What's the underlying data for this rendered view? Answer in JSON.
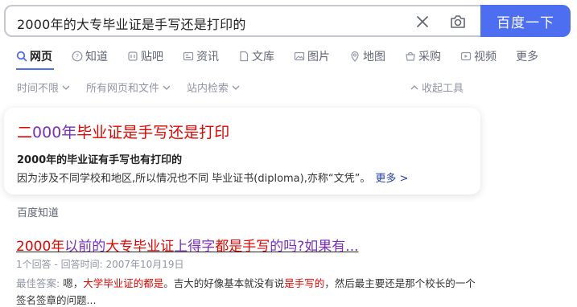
{
  "search": {
    "query": "2000年的大专毕业证是手写还是打印的",
    "button_label": "百度一下"
  },
  "tabs": [
    {
      "label": "网页",
      "icon": "search-icon",
      "active": true
    },
    {
      "label": "知道",
      "icon": "question-icon"
    },
    {
      "label": "贴吧",
      "icon": "tieba-icon"
    },
    {
      "label": "资讯",
      "icon": "news-icon"
    },
    {
      "label": "文库",
      "icon": "document-icon"
    },
    {
      "label": "图片",
      "icon": "image-icon"
    },
    {
      "label": "地图",
      "icon": "map-pin-icon"
    },
    {
      "label": "采购",
      "icon": "shop-icon"
    },
    {
      "label": "视频",
      "icon": "video-icon"
    },
    {
      "label": "更多",
      "icon": ""
    }
  ],
  "filters": {
    "time": "时间不限",
    "file_type": "所有网页和文件",
    "site": "站内检索",
    "collapse": "收起工具"
  },
  "answer_card": {
    "title_parts": [
      {
        "text": "二",
        "style": "red"
      },
      {
        "text": "000年",
        "style": "purple"
      },
      {
        "text": "毕业证是手写还是打印",
        "style": "red"
      }
    ],
    "bold_line": "2000年的毕业证有手写也有打印的",
    "description": "因为涉及不同学校和地区,所以情况也不同 毕业证书(diploma),亦称“文凭”。",
    "more_label": "更多 >"
  },
  "source_label": "百度知道",
  "result": {
    "title_parts": [
      {
        "text": "2000年",
        "style": "red"
      },
      {
        "text": "以前的",
        "style": "purple"
      },
      {
        "text": "大专毕业证",
        "style": "red"
      },
      {
        "text": "上得字",
        "style": "purple"
      },
      {
        "text": "都是手写",
        "style": "red"
      },
      {
        "text": "的吗?如果有...",
        "style": "purple"
      }
    ],
    "meta": "1个回答 - 回答时间: 2007年10月19日",
    "abstract": {
      "label": "最佳答案:",
      "p1": " 嗯，",
      "h1": "大学毕业证的都是",
      "p2": "。吉大的好像基本就没有说",
      "h2": "是手写的",
      "p3": "，然后最主要还是那个校长的一个签名签章的问题..."
    }
  },
  "colors": {
    "accent": "#4e6ef2",
    "highlight_red": "#e10601",
    "visited_purple": "#7a2ec0",
    "link_blue": "#2440b3"
  }
}
